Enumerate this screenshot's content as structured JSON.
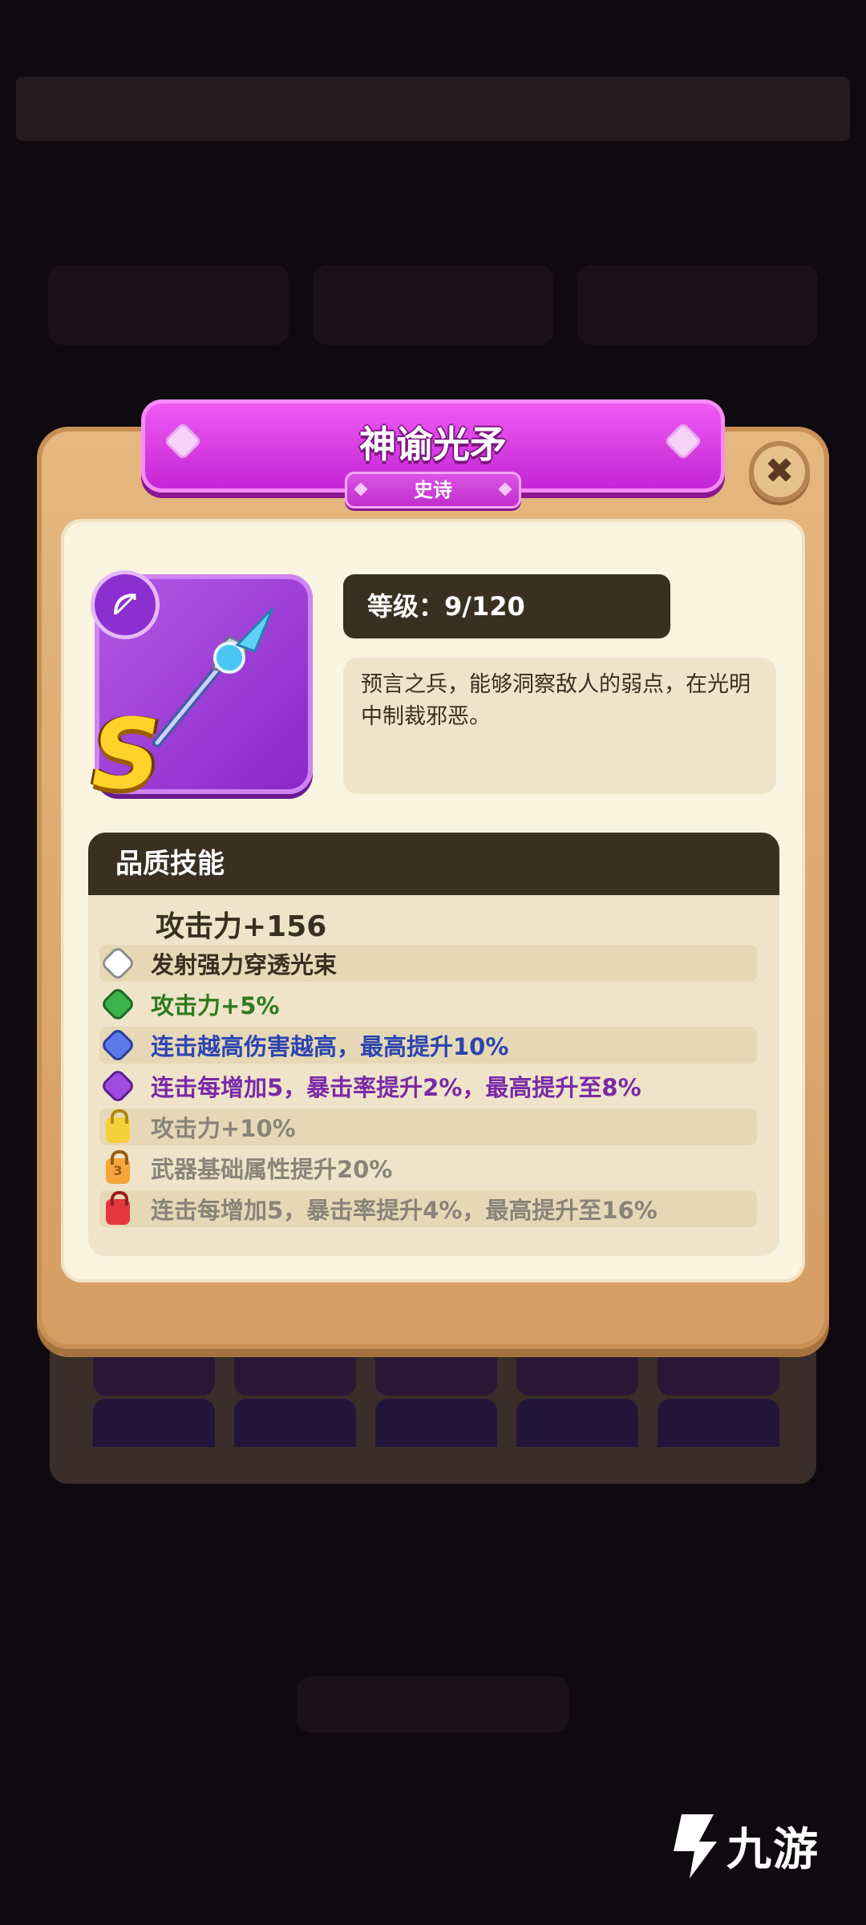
{
  "item": {
    "name": "神谕光矛",
    "rarity": "史诗",
    "grade": "S",
    "level_text": "等级：9/120",
    "description": "预言之兵，能够洞察敌人的弱点，在光明中制裁邪恶。",
    "type_icon": "bow-icon"
  },
  "skills": {
    "header": "品质技能",
    "base_stat": "攻击力+156",
    "rows": [
      {
        "text": "发射强力穿透光束",
        "icon": "white-gem-icon",
        "color": "#3a3021",
        "gem": "#ffffff"
      },
      {
        "text": "攻击力+5%",
        "icon": "green-gem-icon",
        "color": "#2f7a1f",
        "gem": "#3bb24a"
      },
      {
        "text": "连击越高伤害越高，最高提升10%",
        "icon": "blue-gem-icon",
        "color": "#2d45b0",
        "gem": "#5b7bea"
      },
      {
        "text": "连击每增加5，暴击率提升2%，最高提升至8%",
        "icon": "purple-gem-icon",
        "color": "#7a2aa8",
        "gem": "#a04be0"
      },
      {
        "text": "攻击力+10%",
        "icon": "gold-lock-icon",
        "color": "#8a8379",
        "lock": "#f4d13a"
      },
      {
        "text": "武器基础属性提升20%",
        "icon": "orange-lock-icon",
        "color": "#8a8379",
        "lock": "#f5a53a",
        "lock_label": "3"
      },
      {
        "text": "连击每增加5，暴击率提升4%，最高提升至16%",
        "icon": "red-lock-icon",
        "color": "#8a8379",
        "lock": "#e2373c"
      }
    ]
  },
  "close": {
    "label": "✖"
  },
  "watermark": {
    "text": "九游"
  }
}
